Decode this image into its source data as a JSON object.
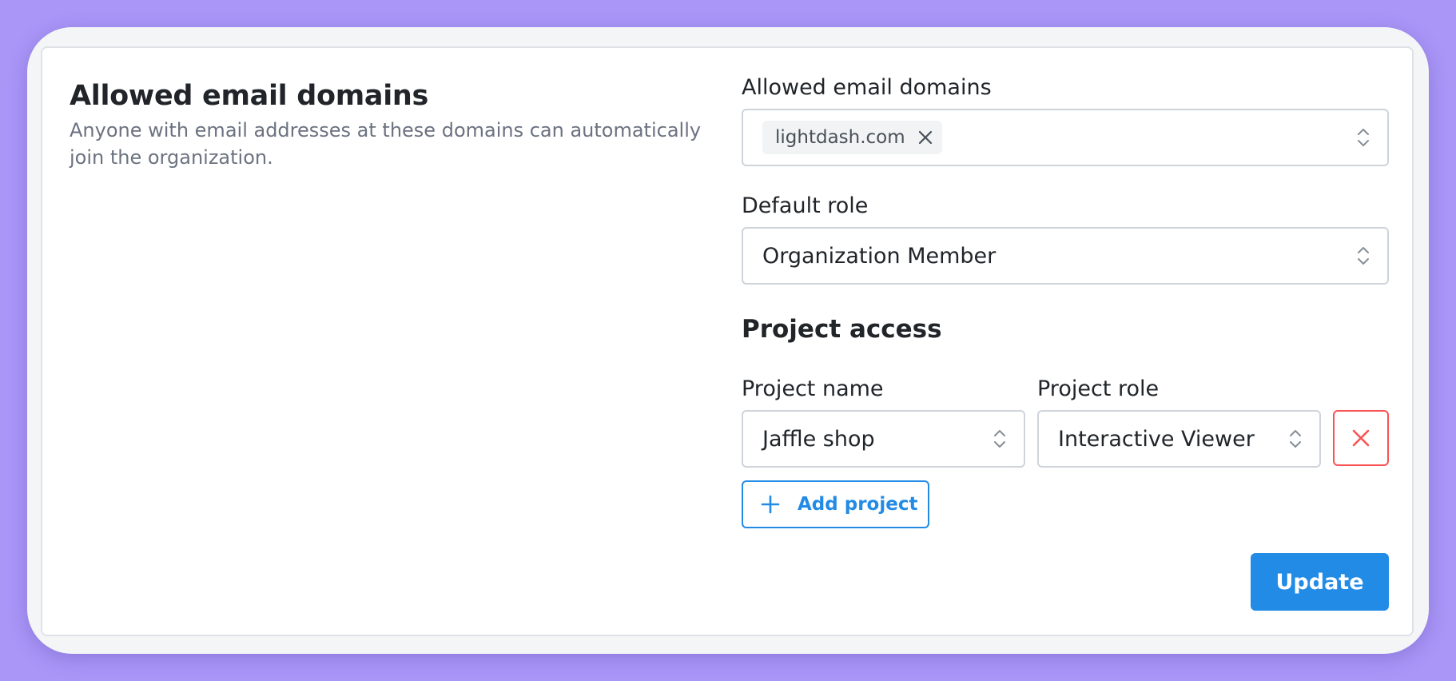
{
  "section": {
    "title": "Allowed email domains",
    "description": "Anyone with email addresses at these domains can automatically join the organization."
  },
  "domains_field": {
    "label": "Allowed email domains",
    "tags": [
      "lightdash.com"
    ]
  },
  "default_role_field": {
    "label": "Default role",
    "value": "Organization Member"
  },
  "project_access": {
    "title": "Project access",
    "project_name_label": "Project name",
    "project_role_label": "Project role",
    "rows": [
      {
        "project": "Jaffle shop",
        "role": "Interactive Viewer"
      }
    ],
    "add_label": "Add project"
  },
  "actions": {
    "update_label": "Update"
  },
  "colors": {
    "background": "#a996f7",
    "primary": "#228be6",
    "danger": "#fa5252",
    "border": "#ced4da"
  }
}
